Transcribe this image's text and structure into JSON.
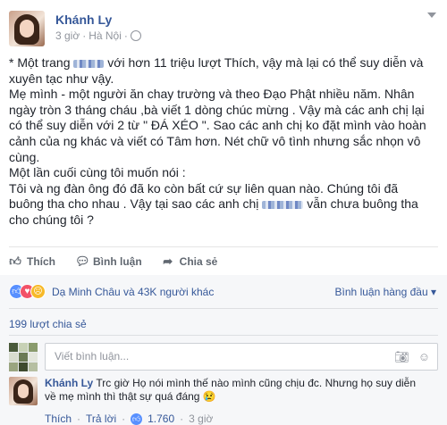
{
  "post": {
    "author": "Khánh Ly",
    "time": "3 giờ",
    "location": "Hà Nội",
    "paragraphs": {
      "p1a": "* Một trang ",
      "p1b": " với hơn 11 triệu lượt Thích, vậy mà lại có thể suy diễn và xuyên tạc như vậy.",
      "p2": "Mẹ mình - một người ăn chay trường và theo Đạo Phật nhiều năm. Nhân ngày tròn 3 tháng cháu ,bà viết 1 dòng chúc mừng . Vậy mà các anh chị lại có thể suy diễn với 2 từ \" ĐÁ XÉO \". Sao các anh chị ko đặt mình vào hoàn cảnh của ng khác và viết có Tâm hơn. Nét chữ vô tình nhưng sắc nhọn vô cùng.",
      "p3": "Một lần cuối cùng tôi muốn nói :",
      "p4a": "Tôi và ng đàn ông đó đã ko còn bất cứ sự liên quan nào. Chúng tôi đã buông tha cho nhau . Vậy tại sao các anh chị",
      "p4b": " vẫn chưa buông tha cho chúng tôi ?"
    }
  },
  "actions": {
    "like": "Thích",
    "comment": "Bình luận",
    "share": "Chia sẻ"
  },
  "reactions": {
    "summary": "Dạ Minh Châu và 43K người khác",
    "sort": "Bình luận hàng đầu"
  },
  "shares": "199 lượt chia sẻ",
  "comment_input": {
    "placeholder": "Viết bình luận..."
  },
  "reply": {
    "author": "Khánh Ly",
    "text": " Trc giờ Họ nói mình thế nào mình cũng chịu đc. Nhưng họ suy diễn về mẹ mình thì thật sự quá đáng ",
    "like": "Thích",
    "reply": "Trả lời",
    "likes": "1.760",
    "time": "3 giờ"
  },
  "colors": {
    "link": "#365899",
    "like_blue": "#5890ff",
    "love_red": "#f25268",
    "sad_yellow": "#f7b928"
  }
}
